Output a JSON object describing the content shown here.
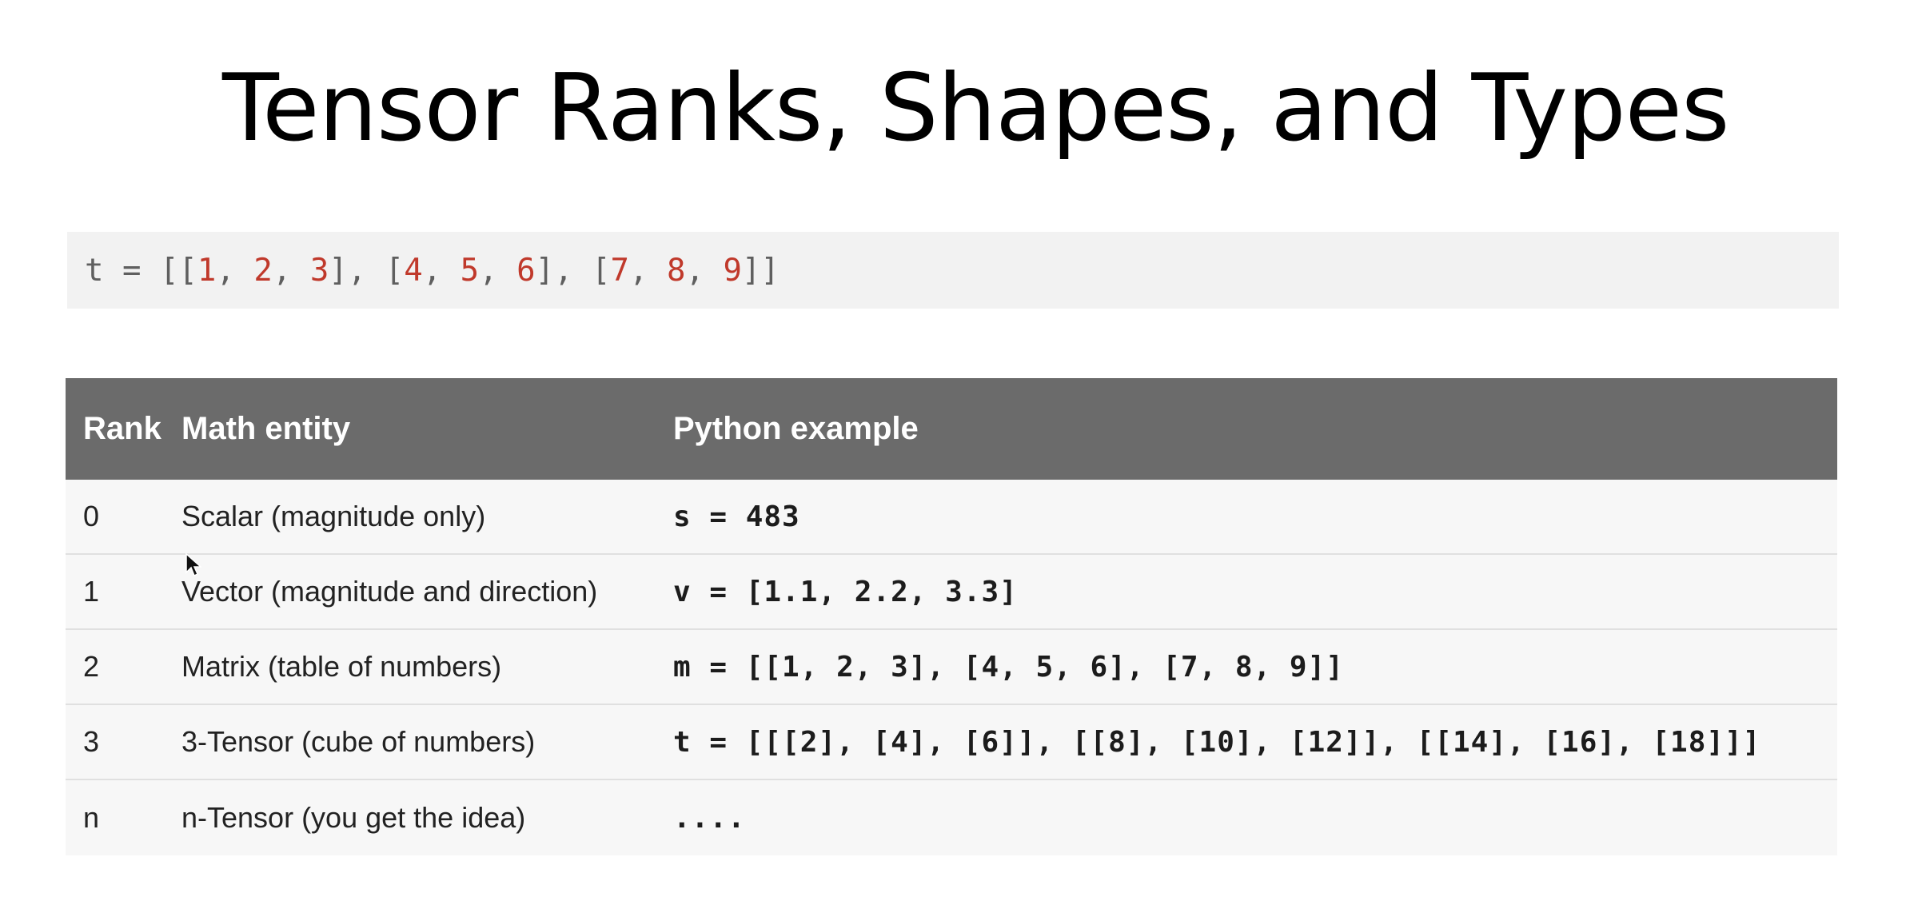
{
  "slide": {
    "title": "Tensor Ranks, Shapes, and Types"
  },
  "code": {
    "variable": "t",
    "assign": " = ",
    "tokens": [
      "[[",
      "1",
      ", ",
      "2",
      ", ",
      "3",
      "], [",
      "4",
      ", ",
      "5",
      ", ",
      "6",
      "], [",
      "7",
      ", ",
      "8",
      ", ",
      "9",
      "]]"
    ]
  },
  "table": {
    "headers": {
      "rank": "Rank",
      "entity": "Math entity",
      "example": "Python example"
    },
    "rows": [
      {
        "rank": "0",
        "entity": "Scalar (magnitude only)",
        "example": "s = 483"
      },
      {
        "rank": "1",
        "entity": "Vector (magnitude and direction)",
        "example": "v = [1.1, 2.2, 3.3]"
      },
      {
        "rank": "2",
        "entity": "Matrix (table of numbers)",
        "example": "m = [[1, 2, 3], [4, 5, 6], [7, 8, 9]]"
      },
      {
        "rank": "3",
        "entity": "3-Tensor (cube of numbers)",
        "example": "t = [[[2], [4], [6]], [[8], [10], [12]], [[14], [16], [18]]]"
      },
      {
        "rank": "n",
        "entity": "n-Tensor (you get the idea)",
        "example": "...."
      }
    ]
  },
  "icons": {
    "cursor": "mouse-pointer-icon"
  }
}
